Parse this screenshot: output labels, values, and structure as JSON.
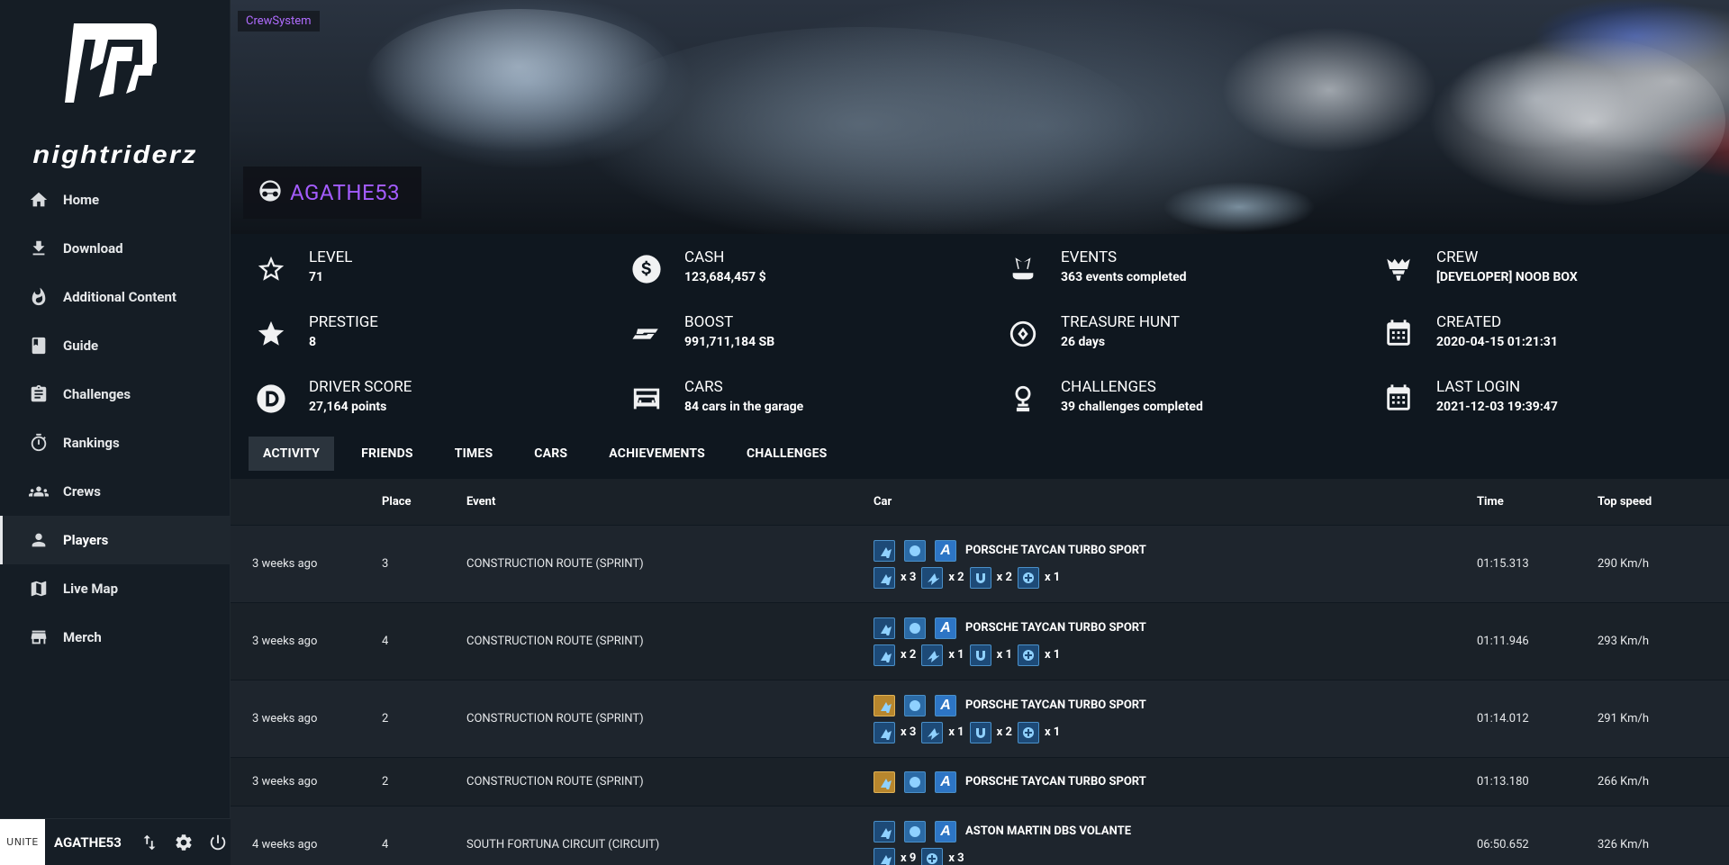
{
  "brand": {
    "name": "nightriderz"
  },
  "nav": [
    {
      "label": "Home",
      "icon": "home-icon"
    },
    {
      "label": "Download",
      "icon": "download-icon"
    },
    {
      "label": "Additional Content",
      "icon": "fire-icon"
    },
    {
      "label": "Guide",
      "icon": "book-icon"
    },
    {
      "label": "Challenges",
      "icon": "clipboard-icon"
    },
    {
      "label": "Rankings",
      "icon": "stopwatch-icon"
    },
    {
      "label": "Crews",
      "icon": "group-icon"
    },
    {
      "label": "Players",
      "icon": "person-icon",
      "active": true
    },
    {
      "label": "Live Map",
      "icon": "map-icon"
    },
    {
      "label": "Merch",
      "icon": "store-icon"
    }
  ],
  "user": {
    "unite_label": "UNITE",
    "name": "AGATHE53"
  },
  "banner": {
    "crew_tag": "CrewSystem",
    "player_name": "AGATHE53"
  },
  "stats": {
    "level": {
      "title": "LEVEL",
      "value": "71"
    },
    "prestige": {
      "title": "PRESTIGE",
      "value": "8"
    },
    "driver_score": {
      "title": "DRIVER SCORE",
      "value": "27,164 points"
    },
    "cash": {
      "title": "CASH",
      "value": "123,684,457 $"
    },
    "boost": {
      "title": "BOOST",
      "value": "991,711,184 SB"
    },
    "cars": {
      "title": "CARS",
      "value": "84 cars in the garage"
    },
    "events": {
      "title": "EVENTS",
      "value": "363 events completed"
    },
    "treasure": {
      "title": "TREASURE HUNT",
      "value": "26 days"
    },
    "challenges": {
      "title": "CHALLENGES",
      "value": "39 challenges completed"
    },
    "crew": {
      "title": "CREW",
      "value": "[DEVELOPER] NOOB BOX"
    },
    "created": {
      "title": "CREATED",
      "value": "2020-04-15 01:21:31"
    },
    "last_login": {
      "title": "LAST LOGIN",
      "value": "2021-12-03 19:39:47"
    }
  },
  "tabs": [
    "ACTIVITY",
    "FRIENDS",
    "TIMES",
    "CARS",
    "ACHIEVEMENTS",
    "CHALLENGES"
  ],
  "table": {
    "headers": {
      "when": "",
      "place": "Place",
      "event": "Event",
      "car": "Car",
      "time": "Time",
      "speed": "Top speed"
    },
    "rows": [
      {
        "when": "3 weeks ago",
        "place": "3",
        "event": "CONSTRUCTION ROUTE (SPRINT)",
        "car": "PORSCHE TAYCAN TURBO SPORT",
        "time": "01:15.313",
        "speed": "290 Km/h",
        "gold": false,
        "mods": [
          "x 3",
          "x 2",
          "x 2",
          "x 1"
        ]
      },
      {
        "when": "3 weeks ago",
        "place": "4",
        "event": "CONSTRUCTION ROUTE (SPRINT)",
        "car": "PORSCHE TAYCAN TURBO SPORT",
        "time": "01:11.946",
        "speed": "293 Km/h",
        "gold": false,
        "mods": [
          "x 2",
          "x 1",
          "x 1",
          "x 1"
        ]
      },
      {
        "when": "3 weeks ago",
        "place": "2",
        "event": "CONSTRUCTION ROUTE (SPRINT)",
        "car": "PORSCHE TAYCAN TURBO SPORT",
        "time": "01:14.012",
        "speed": "291 Km/h",
        "gold": true,
        "mods": [
          "x 3",
          "x 1",
          "x 2",
          "x 1"
        ]
      },
      {
        "when": "3 weeks ago",
        "place": "2",
        "event": "CONSTRUCTION ROUTE (SPRINT)",
        "car": "PORSCHE TAYCAN TURBO SPORT",
        "time": "01:13.180",
        "speed": "266 Km/h",
        "gold": true,
        "mods": []
      },
      {
        "when": "4 weeks ago",
        "place": "4",
        "event": "SOUTH FORTUNA CIRCUIT (CIRCUIT)",
        "car": "ASTON MARTIN DBS VOLANTE",
        "time": "06:50.652",
        "speed": "326 Km/h",
        "gold": false,
        "mods": [
          "x 9",
          "x 3"
        ]
      }
    ]
  }
}
